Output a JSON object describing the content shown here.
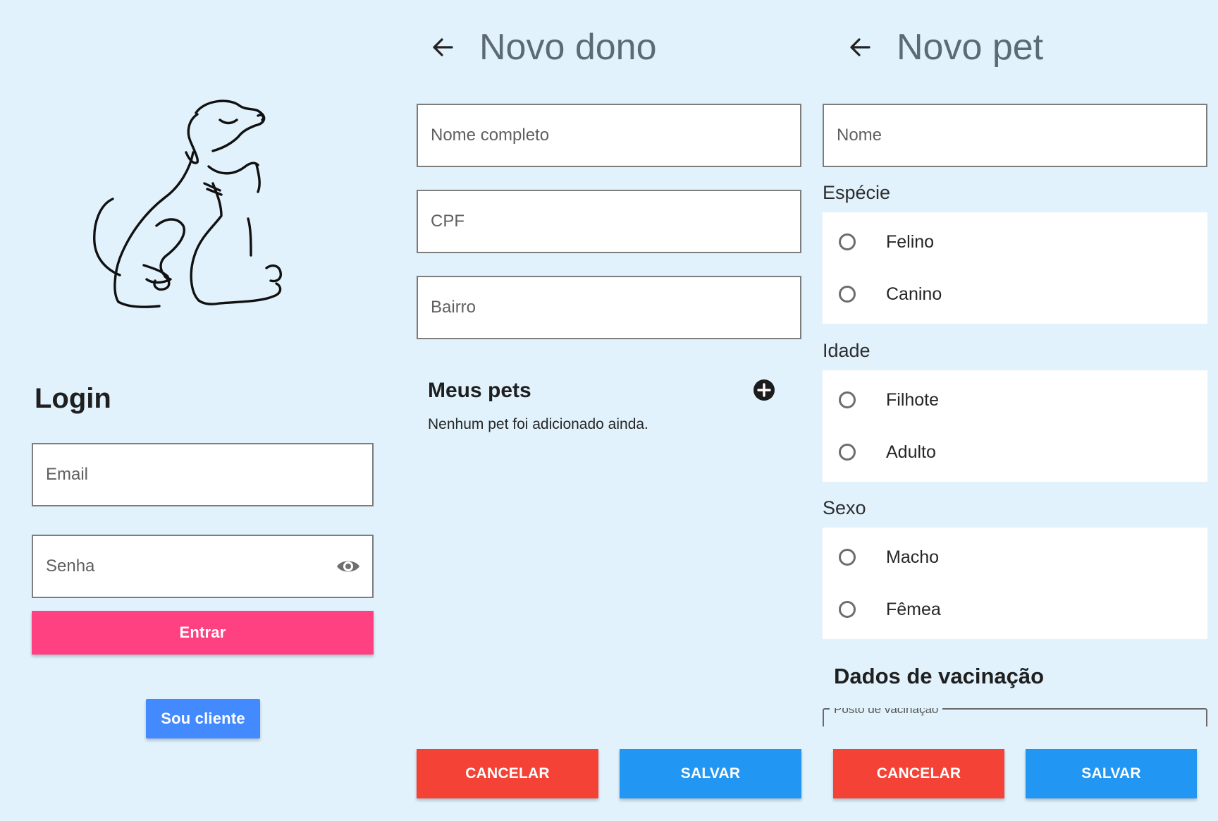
{
  "login": {
    "heading": "Login",
    "email_placeholder": "Email",
    "password_placeholder": "Senha",
    "enter_button": "Entrar",
    "client_button": "Sou cliente"
  },
  "owner_screen": {
    "title": "Novo dono",
    "full_name_placeholder": "Nome completo",
    "cpf_placeholder": "CPF",
    "neighborhood_placeholder": "Bairro",
    "pets_heading": "Meus pets",
    "empty_message": "Nenhum pet foi adicionado ainda.",
    "cancel_button": "CANCELAR",
    "save_button": "SALVAR"
  },
  "pet_screen": {
    "title": "Novo pet",
    "name_placeholder": "Nome",
    "species": {
      "label": "Espécie",
      "options": [
        "Felino",
        "Canino"
      ]
    },
    "age": {
      "label": "Idade",
      "options": [
        "Filhote",
        "Adulto"
      ]
    },
    "sex": {
      "label": "Sexo",
      "options": [
        "Macho",
        "Fêmea"
      ]
    },
    "vaccination_heading": "Dados de vacinação",
    "vaccination_post_label": "Posto de vacinação",
    "cancel_button": "CANCELAR",
    "save_button": "SALVAR"
  },
  "colors": {
    "background": "#e1f2fc",
    "primary_pink": "#ff4081",
    "client_blue": "#448aff",
    "cancel_red": "#f44336",
    "save_blue": "#2196f3"
  },
  "icons": [
    "dog-logo",
    "eye-icon",
    "back-arrow-icon",
    "add-circle-icon"
  ]
}
